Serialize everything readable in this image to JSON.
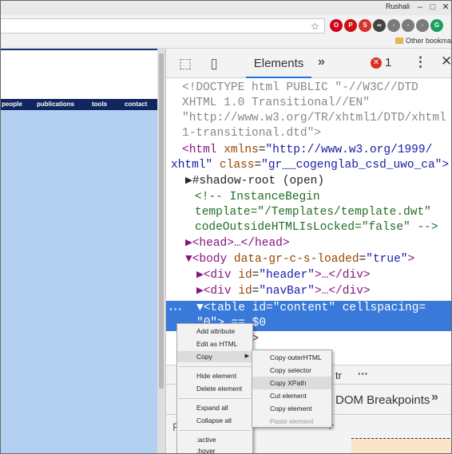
{
  "window": {
    "user_label": "Rushali",
    "min": "–",
    "max": "□",
    "close": "✕"
  },
  "toolbar": {
    "star_icon": "☆",
    "extensions": [
      {
        "name": "opera-icon",
        "glyph": "O",
        "color": "#d0021b"
      },
      {
        "name": "pinterest-icon",
        "glyph": "P",
        "color": "#cc1111"
      },
      {
        "name": "save-icon",
        "glyph": "S",
        "color": "#d9322b"
      },
      {
        "name": "glasses-icon",
        "glyph": "∞",
        "color": "#444444"
      },
      {
        "name": "ext-icon-5",
        "glyph": "◦",
        "color": "#7b7b7b"
      },
      {
        "name": "ext-icon-6",
        "glyph": "◦",
        "color": "#7b7b7b"
      },
      {
        "name": "ext-icon-7",
        "glyph": "◦",
        "color": "#7b7b7b"
      },
      {
        "name": "grammarly-icon",
        "glyph": "G",
        "color": "#15a05a"
      }
    ]
  },
  "bookmarks": {
    "other": "Other bookmarks"
  },
  "page": {
    "nav": [
      "people",
      "publications",
      "tools",
      "contact"
    ]
  },
  "devtools": {
    "inspect_icon": "⬚",
    "device_icon": "▯",
    "tab_elements": "Elements",
    "more_tabs": "»",
    "error_count": "1",
    "menu": "⋮",
    "close": "✕",
    "dom_lines": {
      "l1": "<!DOCTYPE html PUBLIC \"-//W3C//DTD",
      "l2": "XHTML 1.0 Transitional//EN\"",
      "l3": "\"http://www.w3.org/TR/xhtml1/DTD/xhtml",
      "l4": "1-transitional.dtd\">",
      "l5_tag": "<html ",
      "l5_attr": "xmlns",
      "l5_val": "\"http://www.w3.org/1999/",
      "l6_val": "xhtml\"",
      "l6_attr": "class",
      "l6_val2": "\"gr__cogenglab_csd_uwo_ca\">",
      "l7": "▶#shadow-root (open)",
      "l8": "<!-- InstanceBegin",
      "l9": "template=\"/Templates/template.dwt\"",
      "l10": "codeOutsideHTMLIsLocked=\"false\" -->",
      "l11_tag": "▶<head>",
      "l11_rest": "…</head>",
      "l12_tag": "▼<body ",
      "l12_attr": "data-gr-c-s-loaded",
      "l12_val": "\"true\"",
      "l13_tag": "▶<div ",
      "l13_attr": "id",
      "l13_val": "\"header\"",
      "l13_rest": ">…</div>",
      "l14_tag": "▶<div ",
      "l14_attr": "id",
      "l14_val": "\"navBar\"",
      "l14_rest": ">…</div>",
      "sel1": "▼<table id=\"content\" cellspacing=",
      "sel2": "\"0\"> == $0",
      "l15": "dy>",
      "gutter": "···"
    },
    "lower": {
      "tab_partial": "tr",
      "more": "···",
      "breakpoints": "DOM Breakpoints",
      "more_tabs": "»",
      "f_char": "F",
      "plus": "+"
    }
  },
  "context_menu": {
    "add_attribute": "Add attribute",
    "edit_as_html": "Edit as HTML",
    "copy": "Copy",
    "hide_element": "Hide element",
    "delete_element": "Delete element",
    "expand_all": "Expand all",
    "collapse_all": "Collapse all",
    "active": ":active",
    "hover": ":hover"
  },
  "copy_submenu": {
    "copy_outer_html": "Copy outerHTML",
    "copy_selector": "Copy selector",
    "copy_xpath": "Copy XPath",
    "cut_element": "Cut element",
    "copy_element": "Copy element",
    "paste_element": "Paste element"
  }
}
